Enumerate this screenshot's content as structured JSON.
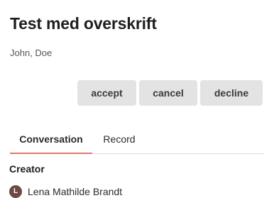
{
  "header": {
    "title": "Test med overskrift",
    "author": "John, Doe"
  },
  "actions": {
    "accept_label": "accept",
    "cancel_label": "cancel",
    "decline_label": "decline"
  },
  "tabs": [
    {
      "label": "Conversation",
      "active": true
    },
    {
      "label": "Record",
      "active": false
    }
  ],
  "creator": {
    "heading": "Creator",
    "avatar_initial": "L",
    "name": "Lena Mathilde Brandt"
  },
  "colors": {
    "accent_underline": "#e07a6e",
    "button_bg": "#e3e3e3",
    "avatar_bg": "#6b4a3f"
  }
}
